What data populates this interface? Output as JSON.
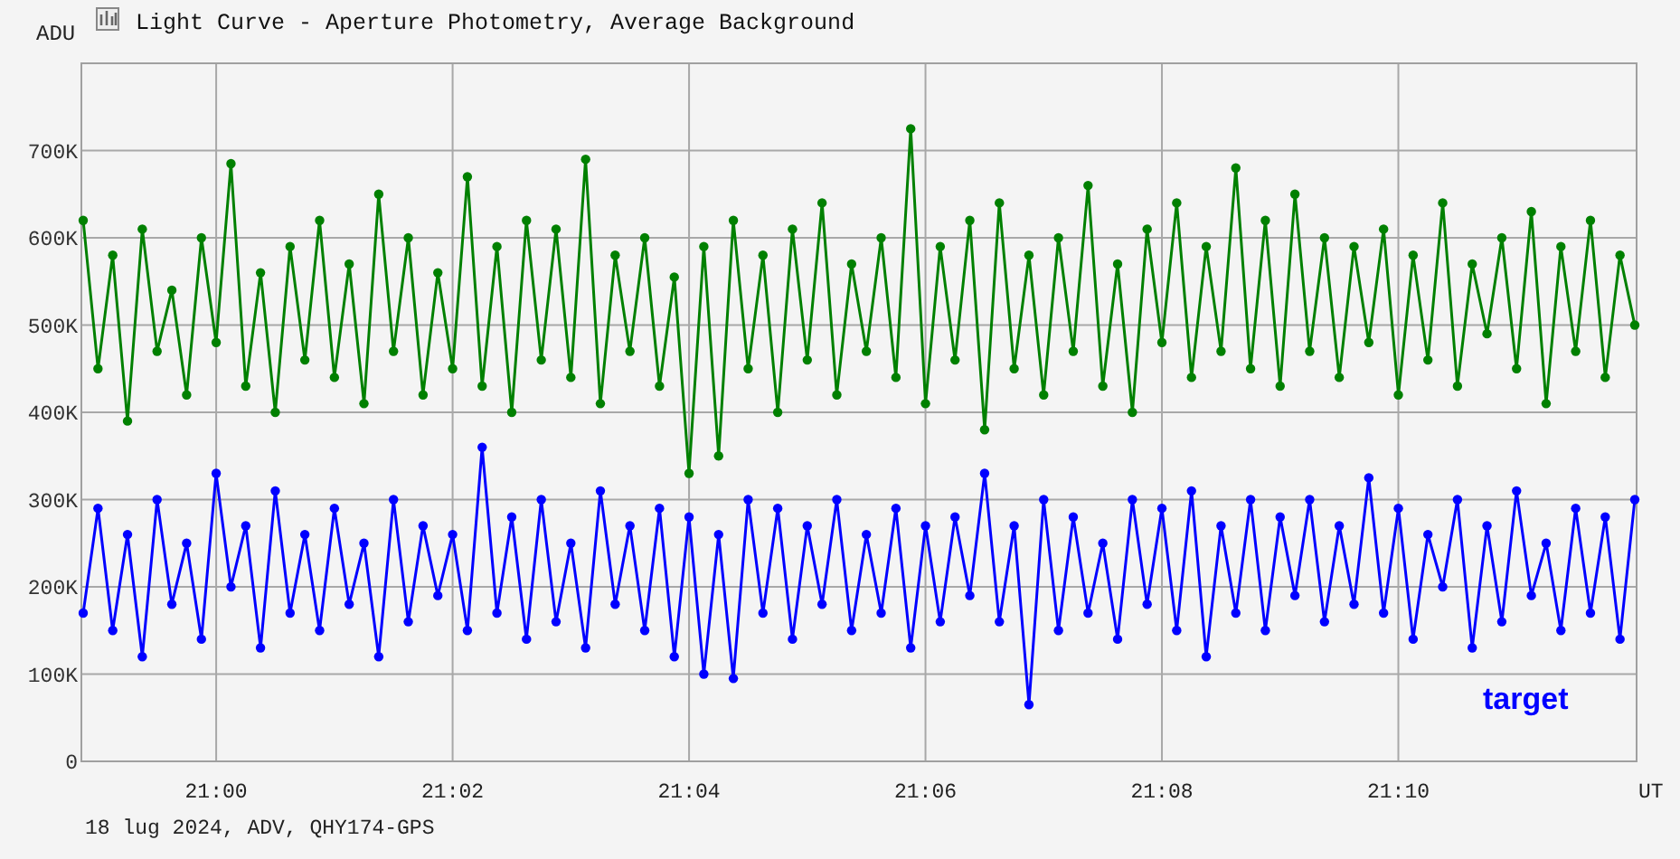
{
  "chart": {
    "chart_data": {
      "type": "line",
      "title": "Light Curve - Aperture Photometry, Average Background",
      "xlabel": "UT",
      "grid": true,
      "ylabel": "ADU",
      "ylim": [
        0,
        800000
      ],
      "yticks": [
        {
          "value": 0,
          "label": "0"
        },
        {
          "value": 100000,
          "label": "100K"
        },
        {
          "value": 200000,
          "label": "200K"
        },
        {
          "value": 300000,
          "label": "300K"
        },
        {
          "value": 400000,
          "label": "400K"
        },
        {
          "value": 500000,
          "label": "500K"
        },
        {
          "value": 600000,
          "label": "600K"
        },
        {
          "value": 700000,
          "label": "700K"
        }
      ],
      "categories": [
        null,
        null,
        null,
        null,
        null,
        null,
        null,
        null,
        null,
        "21:00",
        null,
        null,
        null,
        null,
        null,
        null,
        null,
        null,
        null,
        null,
        null,
        null,
        null,
        null,
        null,
        "21:02",
        null,
        null,
        null,
        null,
        null,
        null,
        null,
        null,
        null,
        null,
        null,
        null,
        null,
        null,
        null,
        "21:04",
        null,
        null,
        null,
        null,
        null,
        null,
        null,
        null,
        null,
        null,
        null,
        null,
        null,
        null,
        null,
        "21:06",
        null,
        null,
        null,
        null,
        null,
        null,
        null,
        null,
        null,
        null,
        null,
        null,
        null,
        null,
        null,
        "21:08",
        null,
        null,
        null,
        null,
        null,
        null,
        null,
        null,
        null,
        null,
        null,
        null,
        null,
        null,
        null,
        "21:10",
        null,
        null,
        null,
        null,
        null,
        null,
        null,
        null,
        null,
        null,
        null,
        null,
        null,
        null,
        null,
        null
      ],
      "series": [
        {
          "color": "#008000",
          "marker": "circle",
          "values": [
            620000,
            450000,
            580000,
            390000,
            610000,
            470000,
            540000,
            420000,
            600000,
            480000,
            685000,
            430000,
            560000,
            400000,
            590000,
            460000,
            620000,
            440000,
            570000,
            410000,
            650000,
            470000,
            600000,
            420000,
            560000,
            450000,
            670000,
            430000,
            590000,
            400000,
            620000,
            460000,
            610000,
            440000,
            690000,
            410000,
            580000,
            470000,
            600000,
            430000,
            555000,
            330000,
            590000,
            350000,
            620000,
            450000,
            580000,
            400000,
            610000,
            460000,
            640000,
            420000,
            570000,
            470000,
            600000,
            440000,
            725000,
            410000,
            590000,
            460000,
            620000,
            380000,
            640000,
            450000,
            580000,
            420000,
            600000,
            470000,
            660000,
            430000,
            570000,
            400000,
            610000,
            480000,
            640000,
            440000,
            590000,
            470000,
            680000,
            450000,
            620000,
            430000,
            650000,
            470000,
            600000,
            440000,
            590000,
            480000,
            610000,
            420000,
            580000,
            460000,
            640000,
            430000,
            570000,
            490000,
            600000,
            450000,
            630000,
            410000,
            590000,
            470000,
            620000,
            440000,
            580000,
            500000
          ]
        },
        {
          "name": "target",
          "color": "#0000ff",
          "marker": "circle",
          "values": [
            170000,
            290000,
            150000,
            260000,
            120000,
            300000,
            180000,
            250000,
            140000,
            330000,
            200000,
            270000,
            130000,
            310000,
            170000,
            260000,
            150000,
            290000,
            180000,
            250000,
            120000,
            300000,
            160000,
            270000,
            190000,
            260000,
            150000,
            360000,
            170000,
            280000,
            140000,
            300000,
            160000,
            250000,
            130000,
            310000,
            180000,
            270000,
            150000,
            290000,
            120000,
            280000,
            100000,
            260000,
            95000,
            300000,
            170000,
            290000,
            140000,
            270000,
            180000,
            300000,
            150000,
            260000,
            170000,
            290000,
            130000,
            270000,
            160000,
            280000,
            190000,
            330000,
            160000,
            270000,
            65000,
            300000,
            150000,
            280000,
            170000,
            250000,
            140000,
            300000,
            180000,
            290000,
            150000,
            310000,
            120000,
            270000,
            170000,
            300000,
            150000,
            280000,
            190000,
            300000,
            160000,
            270000,
            180000,
            325000,
            170000,
            290000,
            140000,
            260000,
            200000,
            300000,
            130000,
            270000,
            160000,
            310000,
            190000,
            250000,
            150000,
            290000,
            170000,
            280000,
            140000,
            300000
          ]
        }
      ]
    }
  },
  "footer": "18 lug 2024, ADV, QHY174-GPS"
}
